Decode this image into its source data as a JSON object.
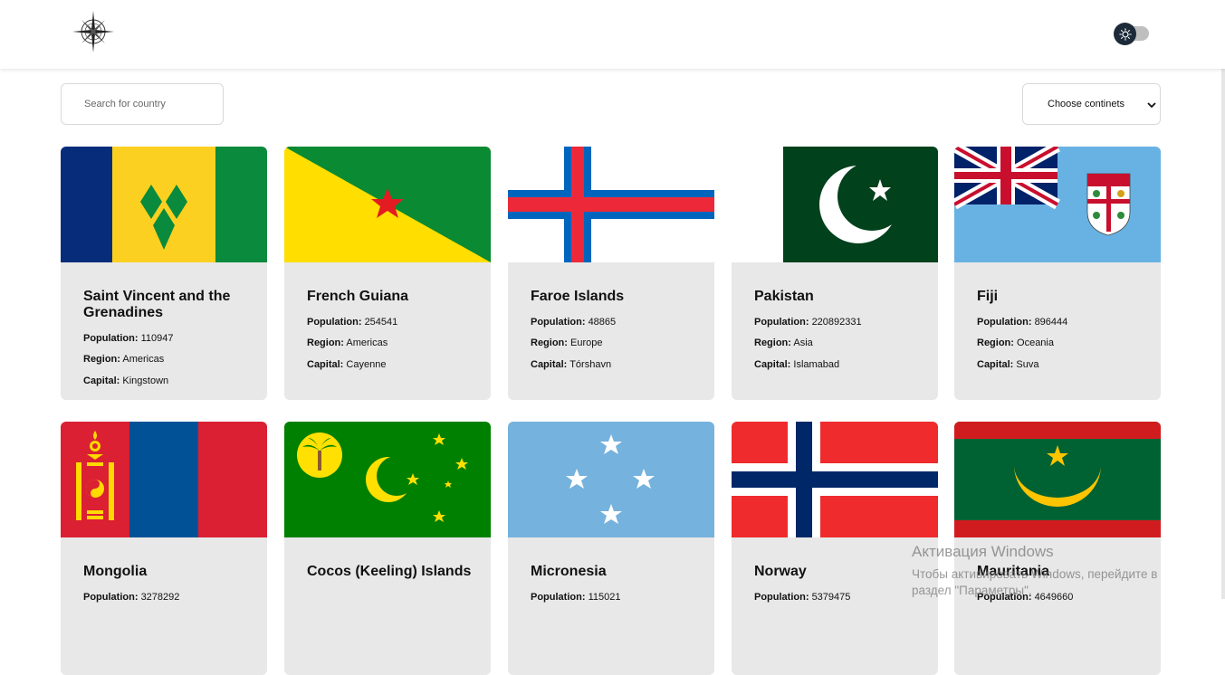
{
  "header": {
    "logo_icon": "compass-logo-icon",
    "theme_icon": "sun-icon"
  },
  "search": {
    "placeholder": "Search for country"
  },
  "filter": {
    "selected": "Choose continets"
  },
  "labels": {
    "population": "Population:",
    "region": "Region:",
    "capital": "Capital:"
  },
  "countries": [
    {
      "name": "Saint Vincent and the Grenadines",
      "population": "110947",
      "region": "Americas",
      "capital": "Kingstown",
      "flag": "flag-vc-icon"
    },
    {
      "name": "French Guiana",
      "population": "254541",
      "region": "Americas",
      "capital": "Cayenne",
      "flag": "flag-gf-icon"
    },
    {
      "name": "Faroe Islands",
      "population": "48865",
      "region": "Europe",
      "capital": "Tórshavn",
      "flag": "flag-fo-icon"
    },
    {
      "name": "Pakistan",
      "population": "220892331",
      "region": "Asia",
      "capital": "Islamabad",
      "flag": "flag-pk-icon"
    },
    {
      "name": "Fiji",
      "population": "896444",
      "region": "Oceania",
      "capital": "Suva",
      "flag": "flag-fj-icon"
    },
    {
      "name": "Mongolia",
      "population": "3278292",
      "region": "",
      "capital": "",
      "flag": "flag-mn-icon"
    },
    {
      "name": "Cocos (Keeling) Islands",
      "population": "",
      "region": "",
      "capital": "",
      "flag": "flag-cc-icon"
    },
    {
      "name": "Micronesia",
      "population": "115021",
      "region": "",
      "capital": "",
      "flag": "flag-fm-icon"
    },
    {
      "name": "Norway",
      "population": "5379475",
      "region": "",
      "capital": "",
      "flag": "flag-no-icon"
    },
    {
      "name": "Mauritania",
      "population": "4649660",
      "region": "",
      "capital": "",
      "flag": "flag-mr-icon"
    }
  ],
  "watermark": {
    "title": "Активация Windows",
    "line1": "Чтобы активировать Windows, перейдите в",
    "line2": "раздел \"Параметры\"."
  }
}
